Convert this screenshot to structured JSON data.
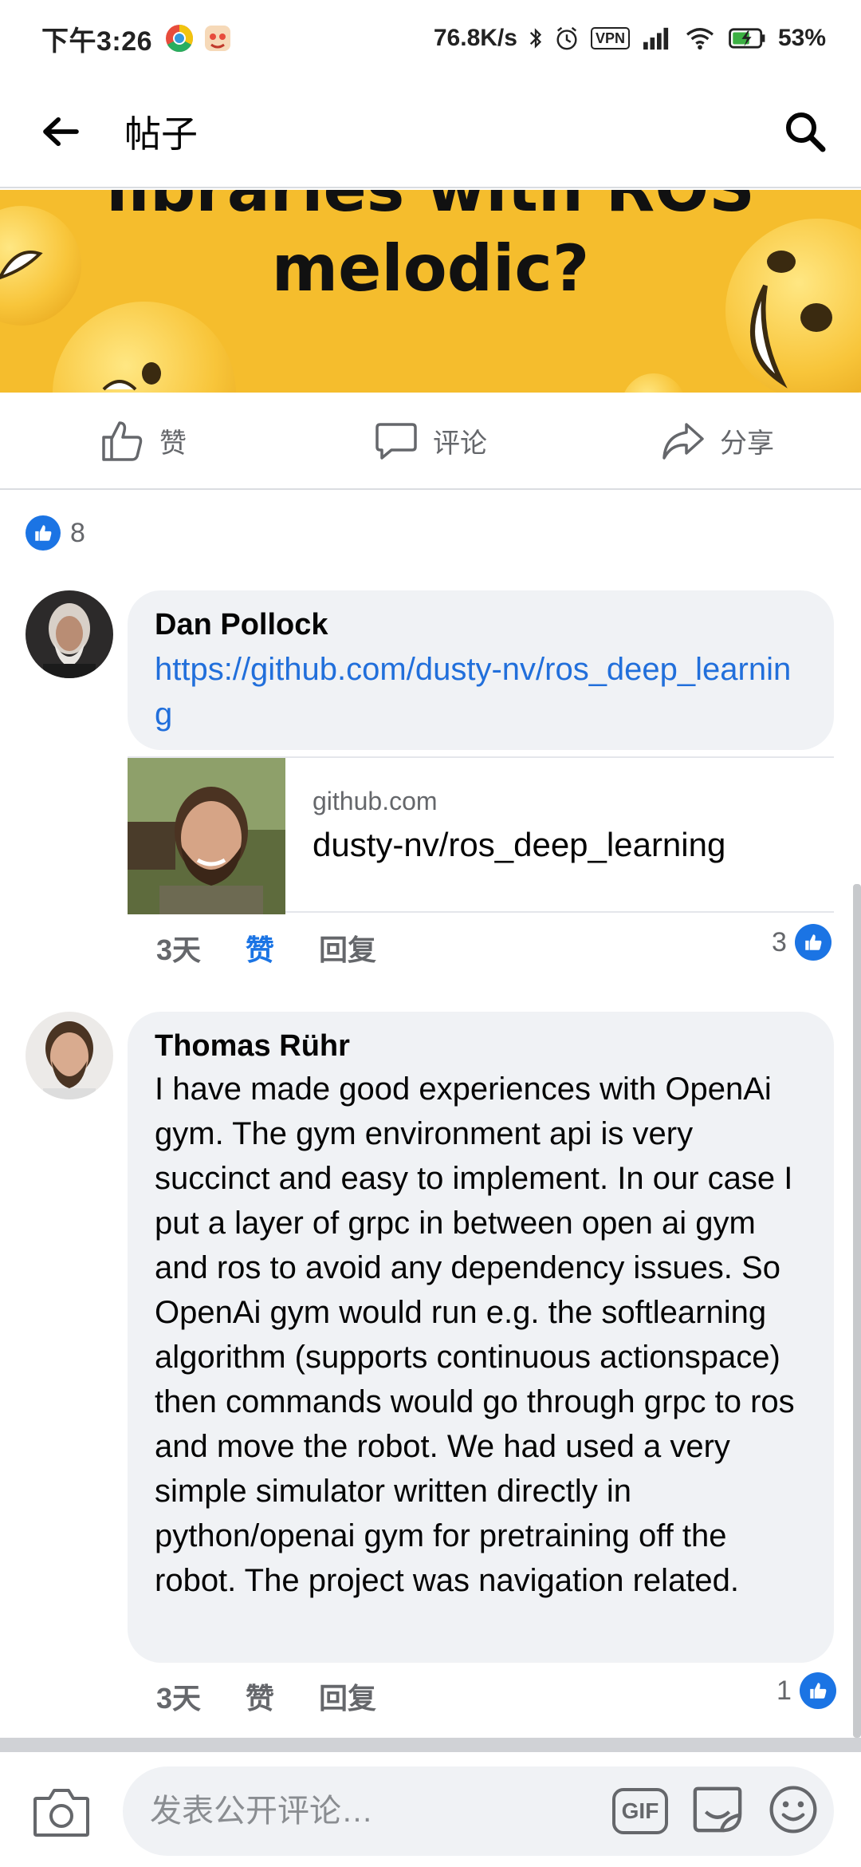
{
  "status_bar": {
    "time": "下午3:26",
    "net_speed": "76.8K/s",
    "vpn_label": "VPN",
    "battery": "53%"
  },
  "header": {
    "title": "帖子"
  },
  "post_banner": {
    "title_line1": "libraries with ROS",
    "title_line2": "melodic?"
  },
  "actions": {
    "like_label": "赞",
    "comment_label": "评论",
    "share_label": "分享"
  },
  "reactions": {
    "count": "8"
  },
  "comments": [
    {
      "author": "Dan Pollock",
      "link": "https://github.com/dusty-nv/ros_deep_learning",
      "preview_domain": "github.com",
      "preview_title": "dusty-nv/ros_deep_learning",
      "time": "3天",
      "like_label": "赞",
      "reply_label": "回复",
      "like_count": "3"
    },
    {
      "author": "Thomas Rühr",
      "text": "I have made good experiences with OpenAi gym. The gym environment api is very succinct and easy to implement. In our case I put a layer of grpc in between open ai gym and ros to avoid any dependency issues. So OpenAi gym would run e.g. the softlearning algorithm (supports continuous actionspace) then commands would go through grpc to ros and move the robot. We had used a very simple simulator written directly in python/openai gym for pretraining off the robot. The project was navigation related.",
      "time": "3天",
      "like_label": "赞",
      "reply_label": "回复",
      "like_count": "1"
    }
  ],
  "composer": {
    "placeholder": "发表公开评论…",
    "gif_label": "GIF"
  },
  "colors": {
    "accent": "#1b74e4",
    "link": "#216fdb",
    "banner": "#f5bd2d",
    "bubble": "#f0f2f5"
  }
}
